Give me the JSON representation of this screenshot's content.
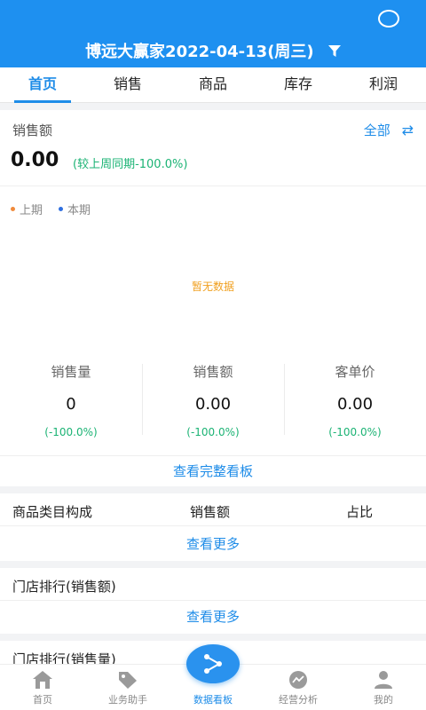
{
  "header": {
    "title": "博远大赢家2022-04-13(周三)",
    "accent": "#1e90f0"
  },
  "tabs": [
    {
      "label": "首页",
      "active": true
    },
    {
      "label": "销售"
    },
    {
      "label": "商品"
    },
    {
      "label": "库存"
    },
    {
      "label": "利润"
    }
  ],
  "sales": {
    "title": "销售额",
    "filter_label": "全部",
    "amount": "0.00",
    "compare": "(较上周同期-100.0%)",
    "legend": [
      {
        "label": "上期",
        "color": "#f08a3c"
      },
      {
        "label": "本期",
        "color": "#2f6fe0"
      }
    ],
    "no_data": "暂无数据",
    "stats": [
      {
        "label": "销售量",
        "value": "0",
        "pct": "(-100.0%)"
      },
      {
        "label": "销售额",
        "value": "0.00",
        "pct": "(-100.0%)"
      },
      {
        "label": "客单价",
        "value": "0.00",
        "pct": "(-100.0%)"
      }
    ],
    "view_board": "查看完整看板"
  },
  "category": {
    "col1": "商品类目构成",
    "col2": "销售额",
    "col3": "占比",
    "more": "查看更多"
  },
  "store_amount": {
    "title": "门店排行(销售额)",
    "more": "查看更多"
  },
  "store_qty": {
    "title": "门店排行(销售量)"
  },
  "bottom_nav": [
    {
      "label": "首页",
      "icon": "home-icon"
    },
    {
      "label": "业务助手",
      "icon": "tag-icon"
    },
    {
      "label": "数据看板",
      "icon": "share-icon",
      "active": true
    },
    {
      "label": "经营分析",
      "icon": "analysis-icon"
    },
    {
      "label": "我的",
      "icon": "user-icon"
    }
  ]
}
